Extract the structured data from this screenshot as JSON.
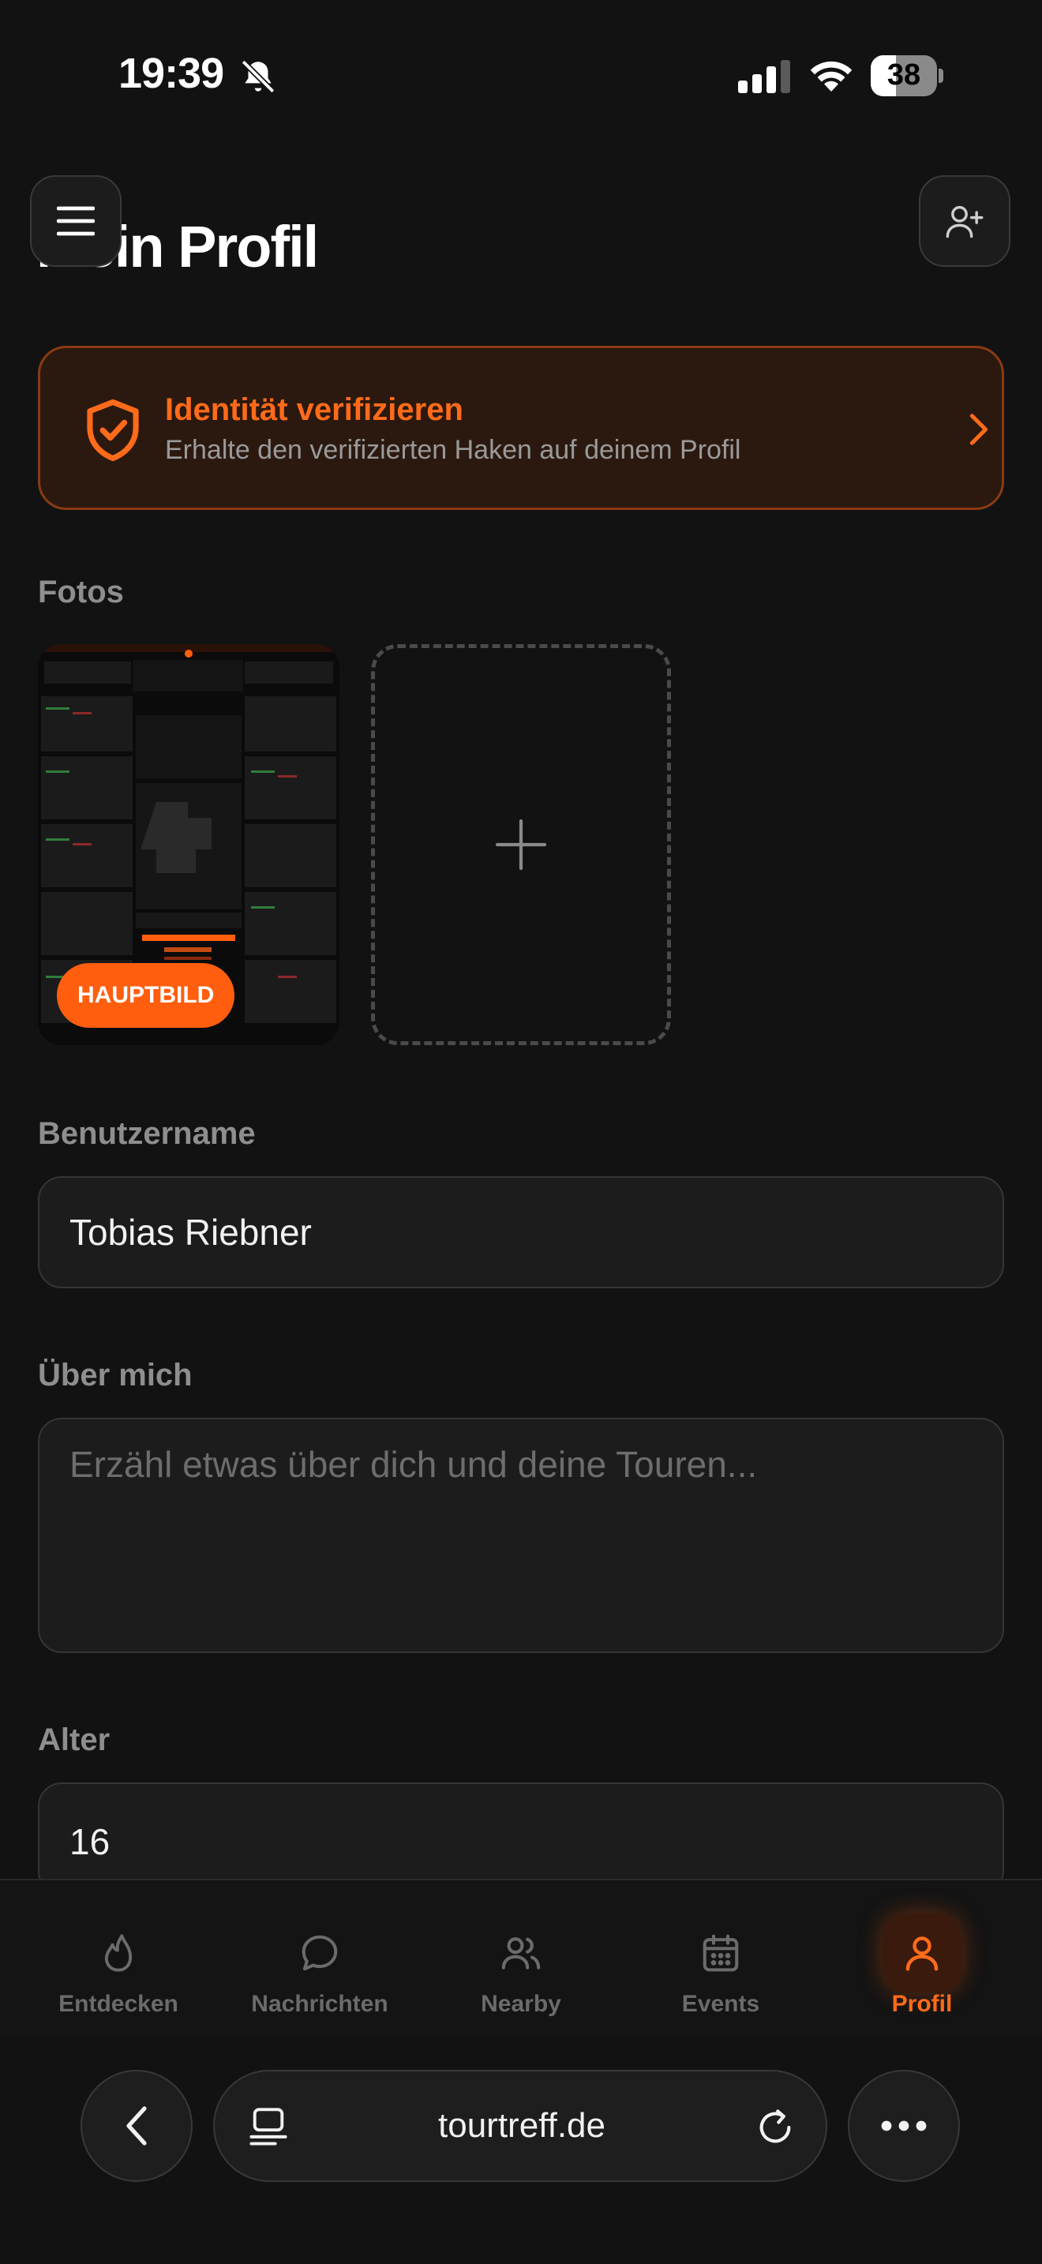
{
  "status_bar": {
    "time": "19:39",
    "battery": "38",
    "battery_level": 0.38
  },
  "header": {
    "title": "Mein Profil"
  },
  "verify_banner": {
    "title": "Identität verifizieren",
    "subtitle": "Erhalte den verifizierten Haken auf deinem Profil"
  },
  "photos": {
    "label": "Fotos",
    "main_badge": "HAUPTBILD"
  },
  "username": {
    "label": "Benutzername",
    "value": "Tobias Riebner"
  },
  "about": {
    "label": "Über mich",
    "placeholder": "Erzähl etwas über dich und deine Touren..."
  },
  "age": {
    "label": "Alter",
    "value": "16"
  },
  "tabs": [
    {
      "label": "Entdecken",
      "icon": "flame-icon",
      "active": false
    },
    {
      "label": "Nachrichten",
      "icon": "chat-bubble-icon",
      "active": false
    },
    {
      "label": "Nearby",
      "icon": "users-icon",
      "active": false
    },
    {
      "label": "Events",
      "icon": "calendar-icon",
      "active": false
    },
    {
      "label": "Profil",
      "icon": "user-icon",
      "active": true
    }
  ],
  "browser": {
    "url": "tourtreff.de"
  },
  "colors": {
    "accent": "#ff6b1a",
    "background": "#121212",
    "surface": "#1c1c1c"
  }
}
